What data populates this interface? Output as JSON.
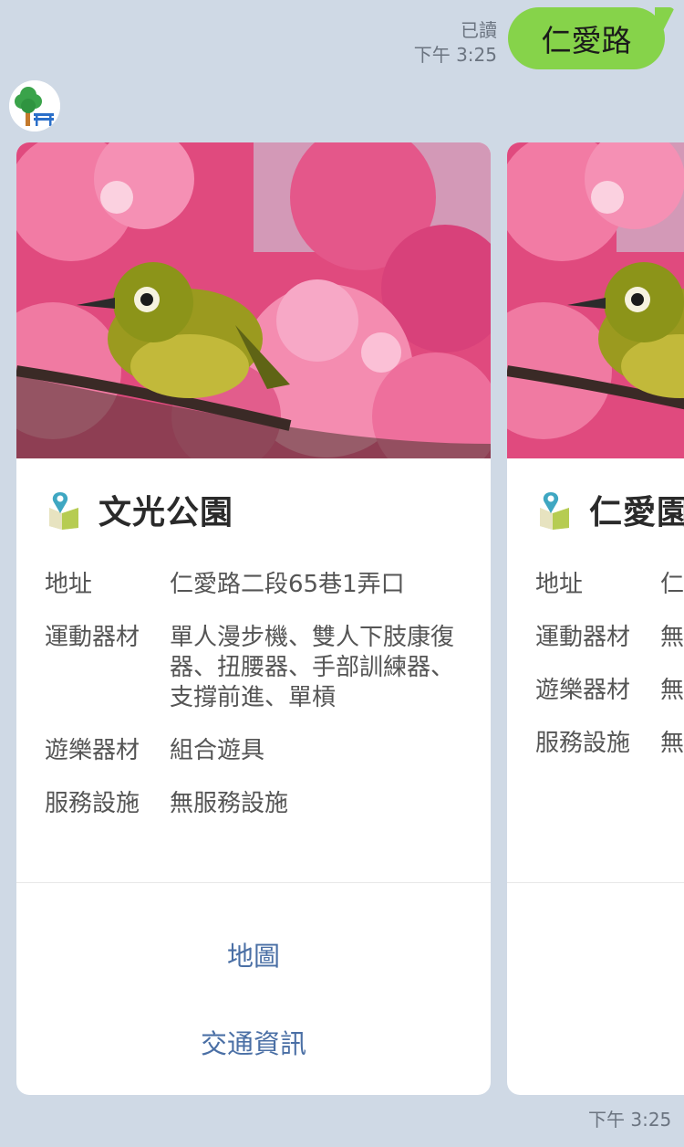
{
  "outgoing": {
    "read_status": "已讀",
    "time": "下午 3:25",
    "text": "仁愛路"
  },
  "incoming_time": "下午 3:25",
  "cards": [
    {
      "title": "文光公園",
      "rows": [
        {
          "label": "地址",
          "value": "仁愛路二段65巷1弄口"
        },
        {
          "label": "運動器材",
          "value": "單人漫步機、雙人下肢康復器、扭腰器、手部訓練器、支撐前進、單槓"
        },
        {
          "label": "遊樂器材",
          "value": "組合遊具"
        },
        {
          "label": "服務設施",
          "value": "無服務設施"
        }
      ],
      "actions": [
        {
          "label": "地圖"
        },
        {
          "label": "交通資訊"
        }
      ]
    },
    {
      "title": "仁愛園",
      "rows": [
        {
          "label": "地址",
          "value": "仁之"
        },
        {
          "label": "運動器材",
          "value": "無"
        },
        {
          "label": "遊樂器材",
          "value": "無"
        },
        {
          "label": "服務設施",
          "value": "無"
        }
      ]
    }
  ],
  "icons": {
    "avatar": "tree-bench-icon",
    "title": "map-pin-icon"
  },
  "colors": {
    "background": "#cfd9e5",
    "bubble": "#86d34a",
    "action_text": "#4a6fa5"
  }
}
